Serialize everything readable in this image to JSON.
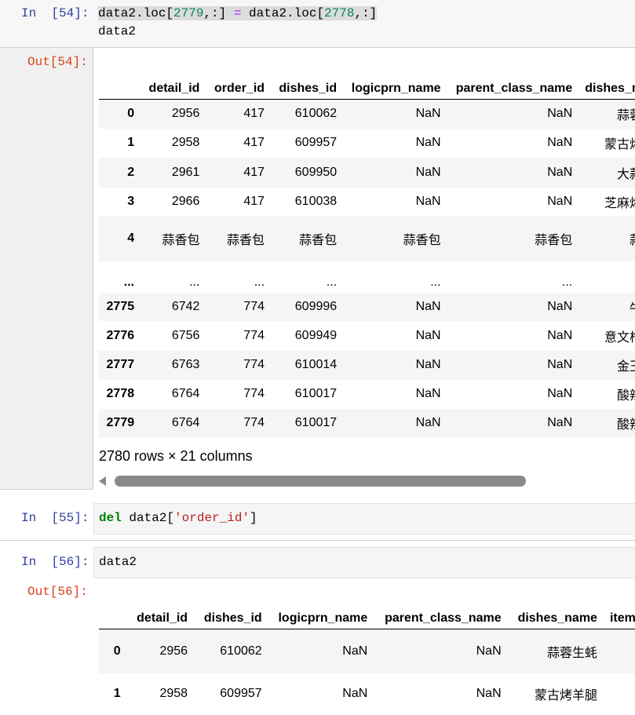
{
  "cell54": {
    "in_prompt": "In  [54]:",
    "code_line1_parts": [
      "data2.loc[",
      "2779",
      ",:] ",
      "=",
      " data2.loc[",
      "2778",
      ",:]"
    ],
    "code_line2": "data2",
    "out_prompt": "Out[54]:",
    "table": {
      "columns": [
        "",
        "detail_id",
        "order_id",
        "dishes_id",
        "logicprn_name",
        "parent_class_name",
        "dishes_n"
      ],
      "rows": [
        [
          "0",
          "2956",
          "417",
          "610062",
          "NaN",
          "NaN",
          "蒜蓉"
        ],
        [
          "1",
          "2958",
          "417",
          "609957",
          "NaN",
          "NaN",
          "蒙古烤"
        ],
        [
          "2",
          "2961",
          "417",
          "609950",
          "NaN",
          "NaN",
          "大蒜"
        ],
        [
          "3",
          "2966",
          "417",
          "610038",
          "NaN",
          "NaN",
          "芝麻烤"
        ],
        [
          "4",
          "蒜香包",
          "蒜香包",
          "蒜香包",
          "蒜香包",
          "蒜香包",
          "蒜"
        ],
        [
          "...",
          "...",
          "...",
          "...",
          "...",
          "...",
          ""
        ],
        [
          "2775",
          "6742",
          "774",
          "609996",
          "NaN",
          "NaN",
          "牛"
        ],
        [
          "2776",
          "6756",
          "774",
          "609949",
          "NaN",
          "NaN",
          "意文柠"
        ],
        [
          "2777",
          "6763",
          "774",
          "610014",
          "NaN",
          "NaN",
          "金玉"
        ],
        [
          "2778",
          "6764",
          "774",
          "610017",
          "NaN",
          "NaN",
          "酸辣"
        ],
        [
          "2779",
          "6764",
          "774",
          "610017",
          "NaN",
          "NaN",
          "酸辣"
        ]
      ]
    },
    "shape_caption": "2780 rows × 21 columns"
  },
  "cell55": {
    "in_prompt": "In  [55]:",
    "code_parts": [
      "del",
      " data2[",
      "'order_id'",
      "]"
    ]
  },
  "cell56": {
    "in_prompt": "In  [56]:",
    "code_line": "data2",
    "out_prompt": "Out[56]:",
    "table": {
      "columns": [
        "",
        "detail_id",
        "dishes_id",
        "logicprn_name",
        "parent_class_name",
        "dishes_name",
        "item"
      ],
      "rows": [
        [
          "0",
          "2956",
          "610062",
          "NaN",
          "NaN",
          "蒜蓉生蚝",
          ""
        ],
        [
          "1",
          "2958",
          "609957",
          "NaN",
          "NaN",
          "蒙古烤羊腿",
          ""
        ]
      ]
    }
  },
  "colors": {
    "in_prompt": "#303f9f",
    "out_prompt": "#d84315",
    "selected_cell_bar": "#42a5f5",
    "row_stripe": "#f5f5f5"
  }
}
